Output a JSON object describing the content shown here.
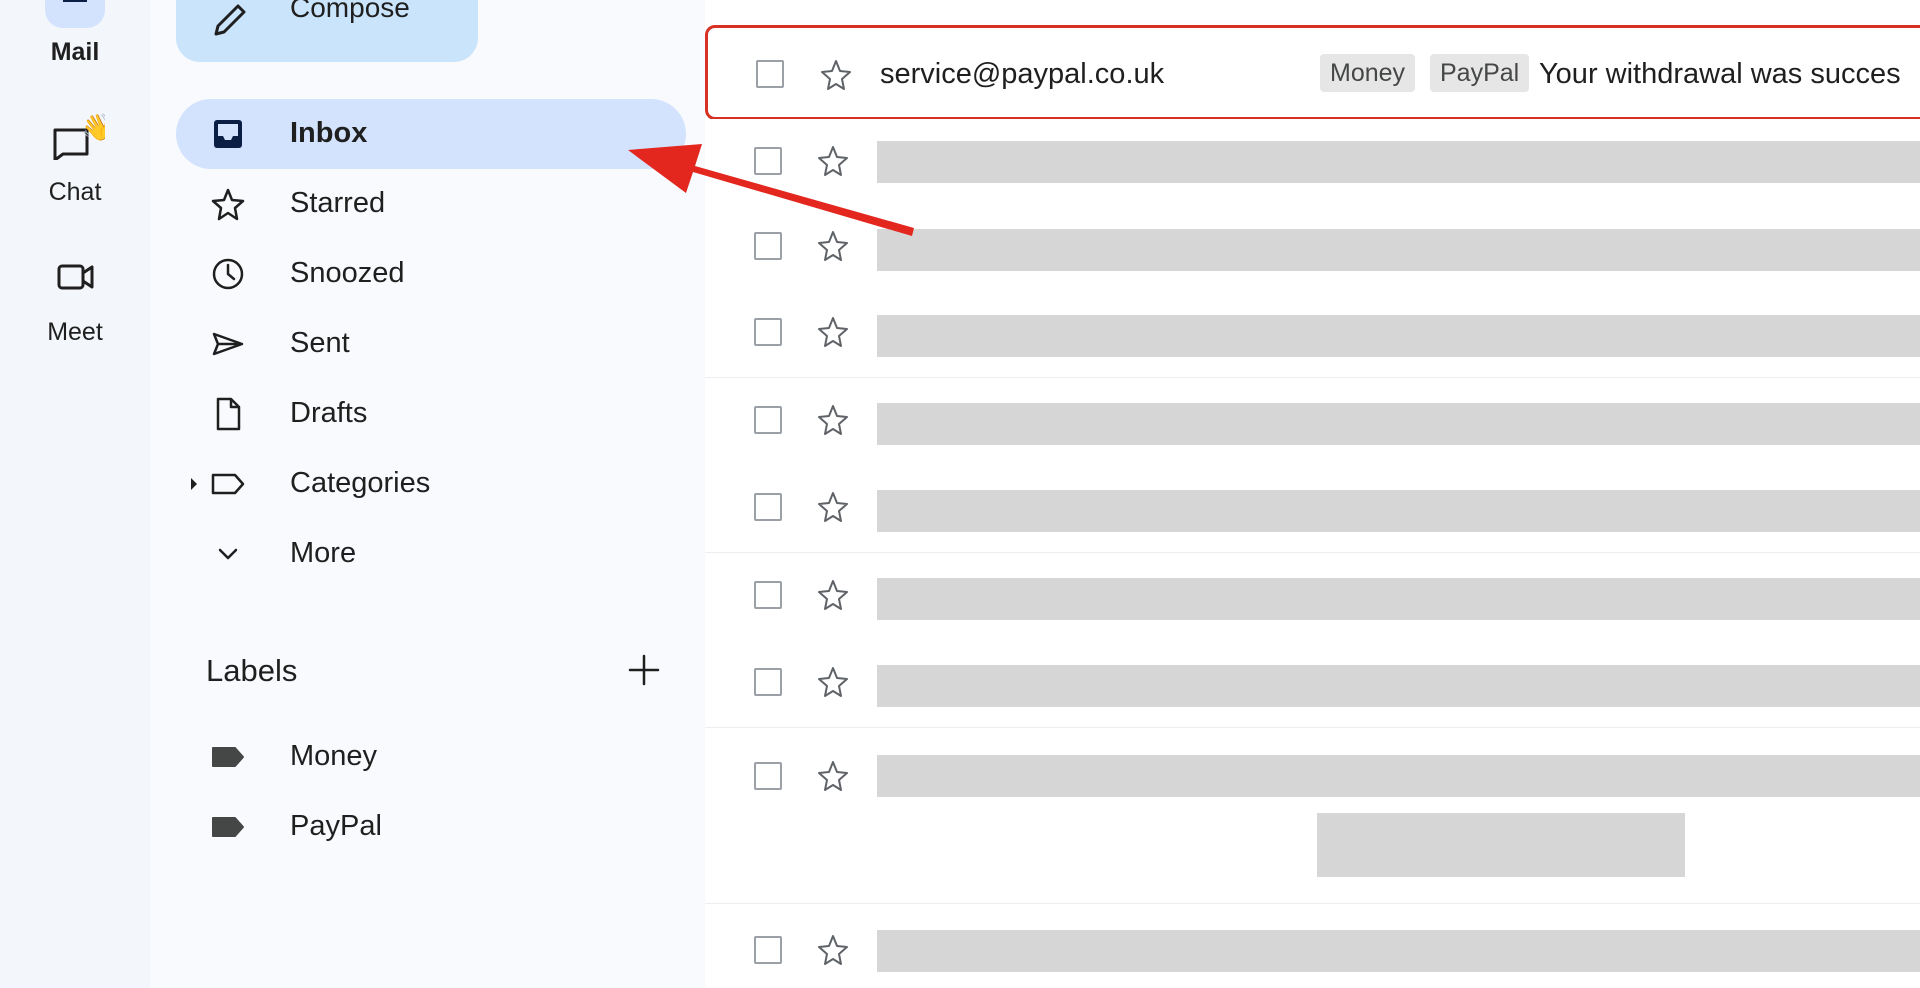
{
  "rail": {
    "items": [
      {
        "label": "Mail",
        "icon": "mail-icon"
      },
      {
        "label": "Chat",
        "icon": "chat-icon"
      },
      {
        "label": "Meet",
        "icon": "video-icon"
      }
    ]
  },
  "compose": {
    "label": "Compose",
    "icon": "pencil-icon"
  },
  "nav": {
    "items": [
      {
        "label": "Inbox",
        "icon": "inbox-icon",
        "active": true
      },
      {
        "label": "Starred",
        "icon": "star-icon"
      },
      {
        "label": "Snoozed",
        "icon": "clock-icon"
      },
      {
        "label": "Sent",
        "icon": "send-icon"
      },
      {
        "label": "Drafts",
        "icon": "draft-icon"
      },
      {
        "label": "Categories",
        "icon": "label-outline-icon"
      },
      {
        "label": "More",
        "icon": "chevron-down-icon"
      }
    ]
  },
  "labels": {
    "heading": "Labels",
    "items": [
      {
        "label": "Money",
        "icon": "label-filled-icon"
      },
      {
        "label": "PayPal",
        "icon": "label-filled-icon"
      }
    ]
  },
  "mail": {
    "first": {
      "sender": "service@paypal.co.uk",
      "chips": [
        "Money",
        "PayPal"
      ],
      "subject": "Your withdrawal was succes"
    }
  },
  "colors": {
    "highlight": "#d93025",
    "arrow": "#e3261e",
    "active_nav": "#d3e3fd",
    "compose": "#c9e4fb"
  }
}
